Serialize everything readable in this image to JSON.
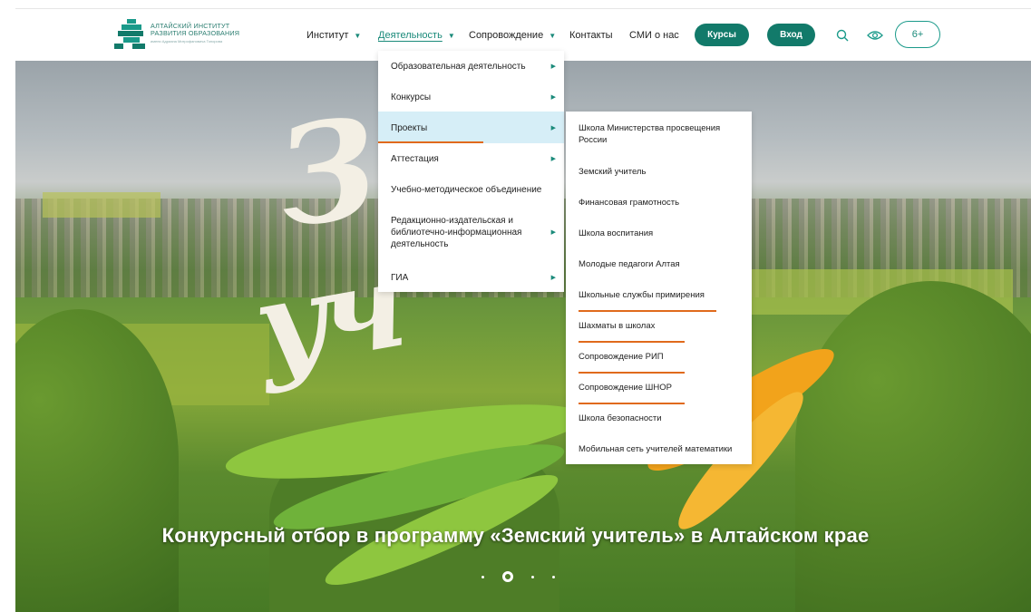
{
  "logo": {
    "line1": "Алтайский институт",
    "line2": "развития образования",
    "line3": "имени Адриана Митрофановича Топорова"
  },
  "nav": [
    {
      "label": "Институт",
      "has_dropdown": true
    },
    {
      "label": "Деятельность",
      "has_dropdown": true,
      "active": true
    },
    {
      "label": "Сопровождение",
      "has_dropdown": true
    },
    {
      "label": "Контакты"
    },
    {
      "label": "СМИ о нас"
    }
  ],
  "buttons": {
    "courses": "Курсы",
    "login": "Вход",
    "age": "6+"
  },
  "icons": {
    "search": "search-icon",
    "accessibility": "eye-icon"
  },
  "menu_level1": [
    {
      "label": "Образовательная деятельность",
      "has_submenu": true
    },
    {
      "label": "Конкурсы",
      "has_submenu": true
    },
    {
      "label": "Проекты",
      "has_submenu": true,
      "highlighted": true
    },
    {
      "label": "Аттестация",
      "has_submenu": true
    },
    {
      "label": "Учебно-методическое объединение",
      "has_submenu": false
    },
    {
      "label": "Редакционно-издательская и библиотечно-информационная деятельность",
      "has_submenu": true
    },
    {
      "label": "ГИА",
      "has_submenu": true
    }
  ],
  "menu_level2": [
    "Школа Министерства просвещения России",
    "Земский учитель",
    "Финансовая грамотность",
    "Школа воспитания",
    "Молодые педагоги Алтая",
    "Школьные службы примирения",
    "Шахматы в школах",
    "Сопровождение РИП",
    "Сопровождение ШНОР",
    "Школа безопасности",
    "Мобильная сеть учителей математики"
  ],
  "slide": {
    "title": "Конкурсный отбор в программу «Земский учитель» в Алтайском крае",
    "artwork_text": "Земский учитель",
    "current": 2,
    "total": 4
  },
  "colors": {
    "accent": "#127a6a",
    "link": "#1a8a7a",
    "underline": "#e06a1c",
    "highlight": "#d6eef7"
  }
}
